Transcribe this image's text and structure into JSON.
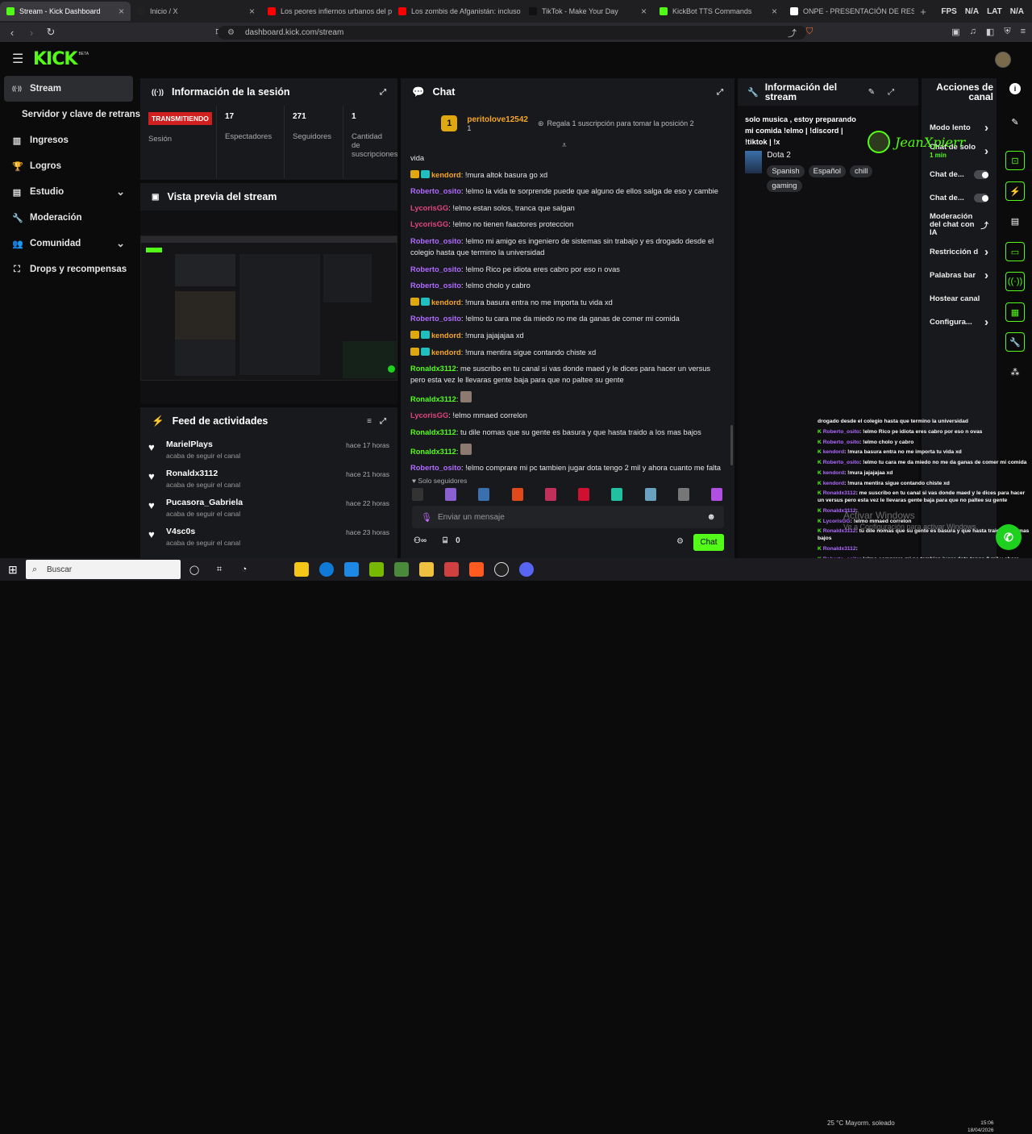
{
  "browser": {
    "tabs": [
      {
        "label": "Stream - Kick Dashboard",
        "color": "#53fc18",
        "active": true
      },
      {
        "label": "Inicio / X",
        "color": "#222222"
      },
      {
        "label": "Los peores infiernos urbanos del pla",
        "color": "#ff0000"
      },
      {
        "label": "Los zombis de Afganistán: incluso lo",
        "color": "#ff0000"
      },
      {
        "label": "TikTok - Make Your Day",
        "color": "#111111"
      },
      {
        "label": "KickBot TTS Commands",
        "color": "#53fc18"
      },
      {
        "label": "ONPE - PRESENTACIÓN DE RESULTA",
        "color": "#ffffff"
      }
    ],
    "right_labels": [
      "FPS",
      "N/A",
      "LAT",
      "N/A"
    ],
    "url": "dashboard.kick.com/stream"
  },
  "brand": {
    "logo": "KICK",
    "beta": "BETA"
  },
  "sidebar": {
    "items": [
      {
        "label": "Stream",
        "icon": "broadcast-icon",
        "glyph": "((·))",
        "active": true
      },
      {
        "label": "Servidor y clave de retransm",
        "sub": true
      },
      {
        "label": "Ingresos",
        "icon": "chart-icon",
        "glyph": "▥"
      },
      {
        "label": "Logros",
        "icon": "trophy-icon",
        "glyph": "🏆"
      },
      {
        "label": "Estudio",
        "icon": "studio-icon",
        "glyph": "▤",
        "chevron": true
      },
      {
        "label": "Moderación",
        "icon": "wrench-icon",
        "glyph": "🔧"
      },
      {
        "label": "Comunidad",
        "icon": "community-icon",
        "glyph": "👥",
        "chevron": true
      },
      {
        "label": "Drops y recompensas",
        "icon": "drops-icon",
        "glyph": "⛶"
      }
    ]
  },
  "session": {
    "title": "Información de la sesión",
    "live_label": "TRANSMITIENDO",
    "session_label": "Sesión",
    "stats": [
      {
        "value": "17",
        "label": "Espectadores"
      },
      {
        "value": "271",
        "label": "Seguidores"
      },
      {
        "value": "1",
        "label": "Cantidad de suscripciones"
      }
    ]
  },
  "preview": {
    "title": "Vista previa del stream"
  },
  "feed": {
    "title": "Feed de actividades",
    "items": [
      {
        "user": "MarielPlays",
        "action": "acaba de seguir el canal",
        "time": "hace 17 horas"
      },
      {
        "user": "Ronaldx3112",
        "action": "acaba de seguir el canal",
        "time": "hace 21 horas"
      },
      {
        "user": "Pucasora_Gabriela",
        "action": "acaba de seguir el canal",
        "time": "hace 22 horas"
      },
      {
        "user": "V4sc0s",
        "action": "acaba de seguir el canal",
        "time": "hace 23 horas"
      }
    ]
  },
  "chat": {
    "title": "Chat",
    "pinned_user": "peritolove12542",
    "pinned_count": "1",
    "gift_text": "Regala 1 suscripción para tomar la posición 2",
    "first_line": "vida",
    "messages": [
      {
        "user": "kendord",
        "color": "#f5a623",
        "badges": true,
        "text": "!mura altok basura go xd"
      },
      {
        "user": "Roberto_osito",
        "color": "#b06bff",
        "text": "!elmo la vida te sorprende puede que alguno de ellos salga de eso y cambie"
      },
      {
        "user": "LycorisGG",
        "color": "#e0457b",
        "text": "!elmo estan solos, tranca que salgan"
      },
      {
        "user": "LycorisGG",
        "color": "#e0457b",
        "text": "!elmo no tienen faactores proteccion"
      },
      {
        "user": "Roberto_osito",
        "color": "#b06bff",
        "text": "!elmo mi amigo es ingeniero de sistemas sin trabajo y es drogado desde el colegio hasta que termino la universidad"
      },
      {
        "user": "Roberto_osito",
        "color": "#b06bff",
        "text": "!elmo Rico pe idiota eres cabro por eso n ovas"
      },
      {
        "user": "Roberto_osito",
        "color": "#b06bff",
        "text": "!elmo cholo y cabro"
      },
      {
        "user": "kendord",
        "color": "#f5a623",
        "badges": true,
        "text": "!mura basura entra no me importa tu vida xd"
      },
      {
        "user": "Roberto_osito",
        "color": "#b06bff",
        "text": "!elmo tu cara me da miedo no me da ganas de comer mi comida"
      },
      {
        "user": "kendord",
        "color": "#f5a623",
        "badges": true,
        "text": "!mura jajajajaa xd"
      },
      {
        "user": "kendord",
        "color": "#f5a623",
        "badges": true,
        "text": "!mura mentira sigue contando chiste xd"
      },
      {
        "user": "Ronaldx3112",
        "color": "#53fc18",
        "text": "me suscribo en tu canal si vas donde maed y le dices para hacer un versus pero esta vez le llevaras gente baja para que no paltee su gente"
      },
      {
        "user": "Ronaldx3112",
        "color": "#53fc18",
        "text": "",
        "emote": true
      },
      {
        "user": "LycorisGG",
        "color": "#e0457b",
        "text": "!elmo mmaed correlon"
      },
      {
        "user": "Ronaldx3112",
        "color": "#53fc18",
        "text": "tu dile nomas que su gente es basura y que hasta traido a los mas bajos"
      },
      {
        "user": "Ronaldx3112",
        "color": "#53fc18",
        "text": "",
        "emote": true
      },
      {
        "user": "Roberto_osito",
        "color": "#b06bff",
        "text": "!elmo comprare mi pc tambien jugar dota tengo 2 mil y ahora cuanto me falta"
      }
    ],
    "followers_only": "Solo seguidores",
    "input_placeholder": "Enviar un mensaje",
    "points": "0",
    "send_label": "Chat",
    "emote_colors": [
      "#333",
      "#8a5fd0",
      "#3a6fb0",
      "#e04a1a",
      "#c0305a",
      "#d01030",
      "#20c0a0",
      "#6aa0c0",
      "#777",
      "#b050e0"
    ]
  },
  "stream_info": {
    "title": "Información del stream",
    "description": "solo musica , estoy preparando mi comida !elmo | !discord | !tiktok | !x",
    "category": "Dota 2",
    "tags": [
      "Spanish",
      "Español",
      "chill",
      "gaming"
    ]
  },
  "actions": {
    "title": "Acciones de canal",
    "items": [
      {
        "label": "Modo lento",
        "type": "chevron"
      },
      {
        "label": "Chat de solo",
        "type": "chevron",
        "sub": "1 min"
      },
      {
        "label": "Chat de...",
        "type": "toggle"
      },
      {
        "label": "Chat de...",
        "type": "toggle"
      },
      {
        "label": "Moderación del chat con IA",
        "type": "external"
      },
      {
        "label": "Restricción d",
        "type": "chevron"
      },
      {
        "label": "Palabras bar",
        "type": "chevron"
      },
      {
        "label": "Hostear canal",
        "type": "none"
      },
      {
        "label": "Configura...",
        "type": "chevron"
      }
    ]
  },
  "watermark": {
    "name": "JeanXpierr"
  },
  "overlay_chat": [
    {
      "user": "",
      "text": "drogado desde el colegio hasta que termino la universidad"
    },
    {
      "user": "Roberto_osito",
      "text": ": !elmo Rico pe idiota eres cabro por eso n ovas"
    },
    {
      "user": "Roberto_osito",
      "text": ": !elmo cholo y cabro"
    },
    {
      "user": "kendord",
      "text": ": !mura basura entra no me importa tu vida xd"
    },
    {
      "user": "Roberto_osito",
      "text": ": !elmo tu cara me da miedo no me da ganas de comer mi comida"
    },
    {
      "user": "kendord",
      "text": ": !mura jajajajaa xd"
    },
    {
      "user": "kendord",
      "text": ": !mura mentira sigue contando chiste xd"
    },
    {
      "user": "Ronaldx3112",
      "text": ": me suscribo en tu canal si vas donde maed y le dices para hacer un versus pero esta vez le llevaras gente baja para que no paltee su gente"
    },
    {
      "user": "Ronaldx3112",
      "text": ":"
    },
    {
      "user": "LycorisGG",
      "text": ": !elmo mmaed correlon"
    },
    {
      "user": "Ronaldx3112",
      "text": ": tu dile nomas que su gente es basura y que hasta traido a los mas bajos"
    },
    {
      "user": "Ronaldx3112",
      "text": ":"
    },
    {
      "user": "Roberto_osito",
      "text": ": !elmo comprare mi pc tambien jugar dota tengo 2 mil y ahora cuanto me falta"
    }
  ],
  "windows": {
    "activate_title": "Activar Windows",
    "activate_sub": "Ve a Configuración para activar Windows.",
    "search": "Buscar",
    "weather": "25 °C  Mayorm. soleado",
    "time": "15:06",
    "date": "18/04/2026"
  }
}
